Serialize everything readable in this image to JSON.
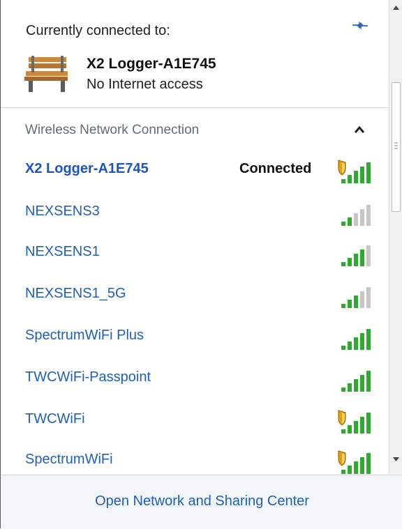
{
  "header": {
    "title": "Currently connected to:",
    "connected_network": "X2 Logger-A1E745",
    "connected_status": "No Internet access"
  },
  "section": {
    "label": "Wireless Network Connection"
  },
  "networks": [
    {
      "name": "X2 Logger-A1E745",
      "status": "Connected",
      "secured": true,
      "bars": 5,
      "color": "#2eaa2e"
    },
    {
      "name": "NEXSENS3",
      "status": "",
      "secured": false,
      "bars": 2,
      "color": "#2eaa2e"
    },
    {
      "name": "NEXSENS1",
      "status": "",
      "secured": false,
      "bars": 4,
      "color": "#2eaa2e"
    },
    {
      "name": "NEXSENS1_5G",
      "status": "",
      "secured": false,
      "bars": 3,
      "color": "#2eaa2e"
    },
    {
      "name": "SpectrumWiFi Plus",
      "status": "",
      "secured": false,
      "bars": 5,
      "color": "#2eaa2e"
    },
    {
      "name": "TWCWiFi-Passpoint",
      "status": "",
      "secured": false,
      "bars": 5,
      "color": "#2eaa2e"
    },
    {
      "name": "TWCWiFi",
      "status": "",
      "secured": true,
      "bars": 5,
      "color": "#2eaa2e"
    },
    {
      "name": "SpectrumWiFi",
      "status": "",
      "secured": true,
      "bars": 5,
      "color": "#2eaa2e"
    }
  ],
  "footer": {
    "link": "Open Network and Sharing Center"
  },
  "icons": {
    "refresh": "refresh-arrows-icon",
    "bench": "park-bench-icon",
    "collapse": "chevron-up-icon",
    "signal": "wifi-signal-icon",
    "shield": "security-shield-icon"
  }
}
